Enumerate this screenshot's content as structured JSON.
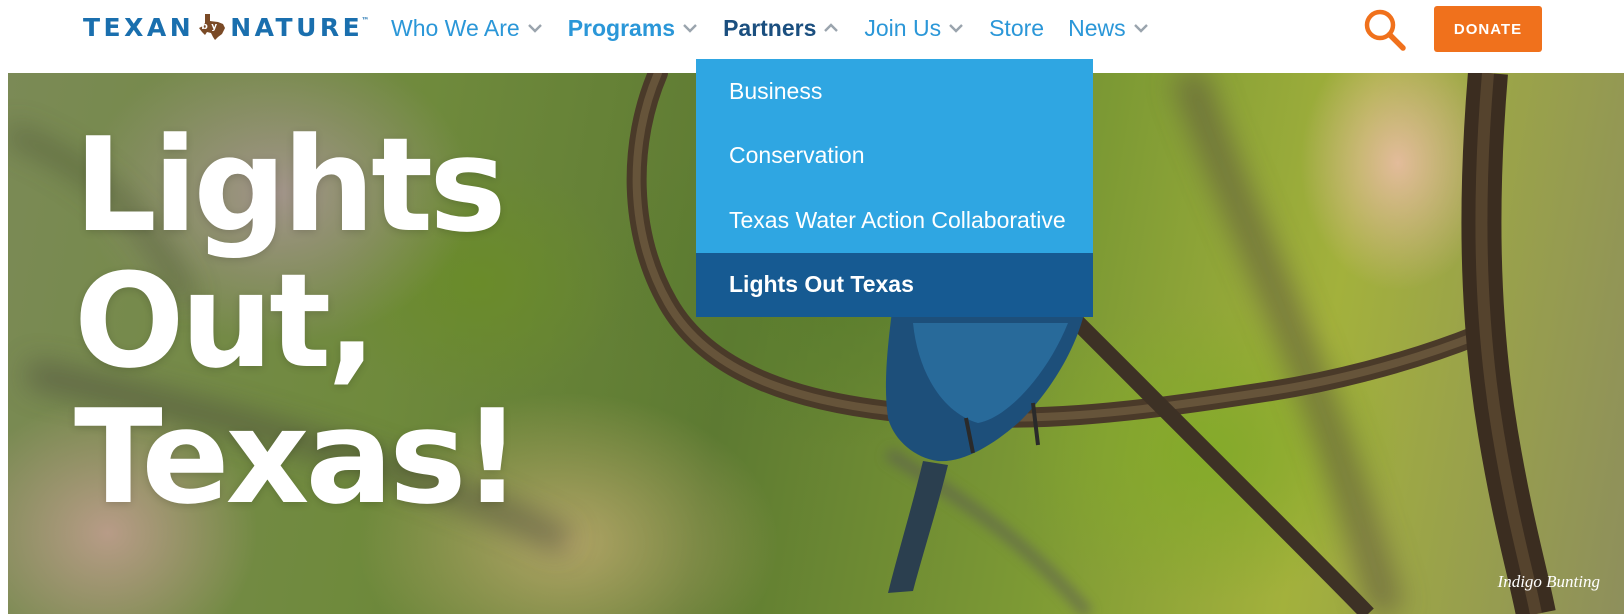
{
  "brand": {
    "logo_left": "TEXAN",
    "logo_right": "NATURE",
    "logo_mark": "by",
    "trademark": "™"
  },
  "nav": {
    "items": [
      {
        "label": "Who We Are",
        "has_dropdown": true
      },
      {
        "label": "Programs",
        "has_dropdown": true
      },
      {
        "label": "Partners",
        "has_dropdown": true,
        "expanded": true
      },
      {
        "label": "Join Us",
        "has_dropdown": true
      },
      {
        "label": "Store",
        "has_dropdown": false
      },
      {
        "label": "News",
        "has_dropdown": true
      }
    ],
    "search_icon": "search-icon",
    "donate_label": "DONATE"
  },
  "dropdown": {
    "items": [
      {
        "label": "Business"
      },
      {
        "label": "Conservation"
      },
      {
        "label": "Texas Water Action Collaborative"
      },
      {
        "label": "Lights Out Texas",
        "active": true
      }
    ]
  },
  "hero": {
    "title_lines": [
      "Lights",
      "Out,",
      "Texas!"
    ],
    "caption": "Indigo Bunting"
  },
  "colors": {
    "brand_blue": "#1a6fae",
    "nav_blue": "#2b97d8",
    "nav_active": "#1b4f7f",
    "dropdown_bg": "#2fa6e2",
    "dropdown_active": "#165a92",
    "donate": "#f0711c"
  }
}
